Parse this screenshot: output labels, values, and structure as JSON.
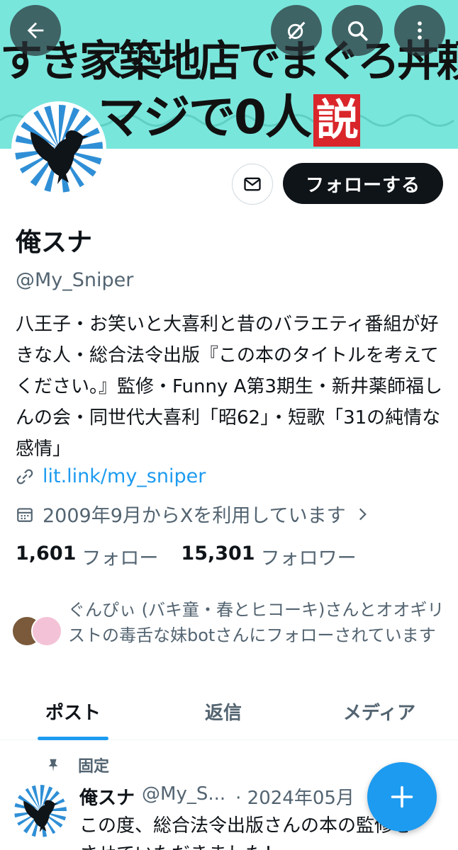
{
  "banner": {
    "line1": "すき家築地店でまぐろ丼頼むヤツ",
    "line2": "マジで0人",
    "line2_red": "説"
  },
  "topbar": {
    "back_icon": "arrow-left-icon",
    "grok_icon": "grok-icon",
    "search_icon": "search-icon",
    "more_icon": "more-vertical-icon"
  },
  "profile": {
    "name": "俺スナ",
    "handle": "@My_Sniper",
    "follow_label": "フォローする",
    "bio": "八王子・お笑いと大喜利と昔のバラエティ番組が好きな人・総合法令出版『この本のタイトルを考えてください。』監修・Funny A第3期生・新井薬師福しんの会・同世代大喜利「昭62」・短歌「31の純情な感情」",
    "link": "lit.link/my_sniper",
    "joined": "2009年9月からXを利用しています",
    "following_count": "1,601",
    "following_label": "フォロー",
    "followers_count": "15,301",
    "followers_label": "フォロワー",
    "followed_by": "ぐんぴぃ (バキ童・春とヒコーキ)さんとオオギリストの毒舌な妹botさんにフォローされています"
  },
  "tabs": [
    {
      "label": "ポスト",
      "active": true
    },
    {
      "label": "返信",
      "active": false
    },
    {
      "label": "メディア",
      "active": false
    }
  ],
  "post": {
    "pinned_label": "固定",
    "name": "俺スナ",
    "handle": "@My_S...",
    "date": "· 2024年05月",
    "text_line1": "この度、総合法令出版さんの本の監修を",
    "text_line2": "させていただきました！"
  },
  "colors": {
    "accent": "#1d9bf0",
    "banner_bg": "#79e6dc",
    "banner_red": "#d9262b",
    "text_primary": "#0f1419",
    "text_secondary": "#536471"
  }
}
